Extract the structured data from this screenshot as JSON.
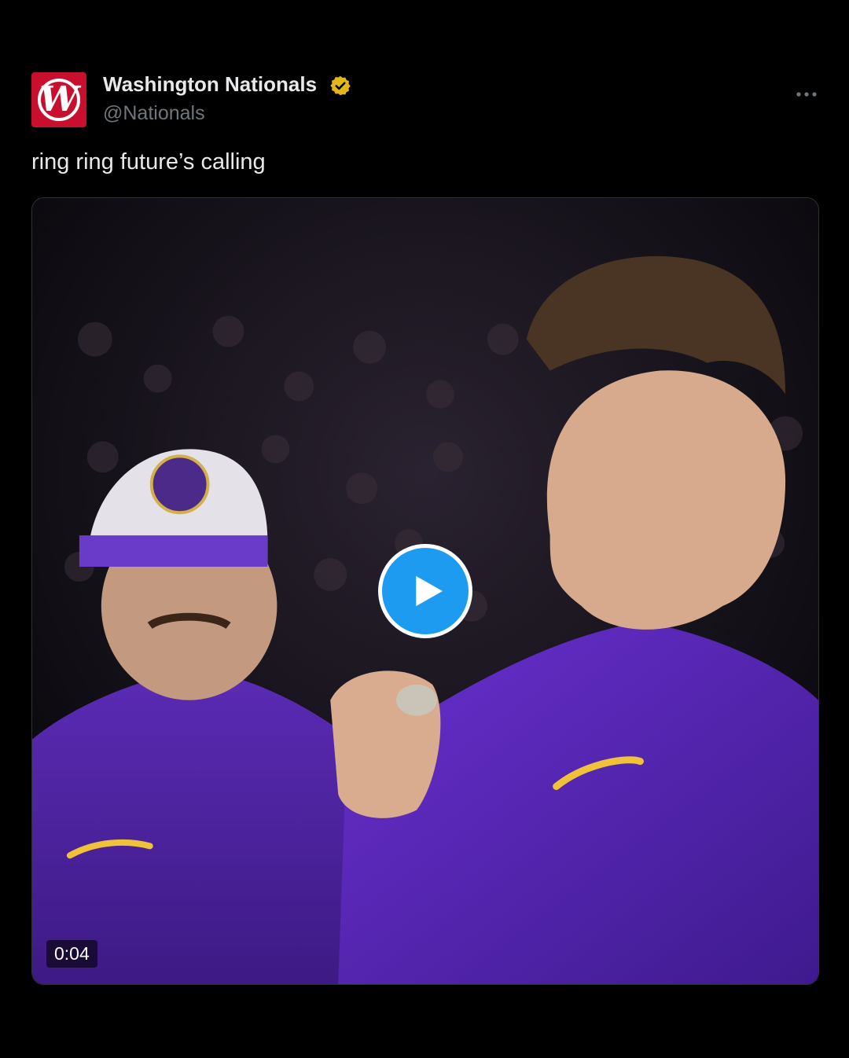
{
  "post": {
    "author": {
      "display_name": "Washington Nationals",
      "handle": "@Nationals",
      "avatar_letter": "W",
      "avatar_color": "#c8102e",
      "verified_badge_color": "#e2b719"
    },
    "text": "ring ring future’s calling",
    "video": {
      "duration": "0:04",
      "play_button_color": "#1d9bf0"
    },
    "icons": {
      "more": "more-horizontal-icon",
      "verified": "verified-badge-icon",
      "play": "play-icon"
    }
  }
}
